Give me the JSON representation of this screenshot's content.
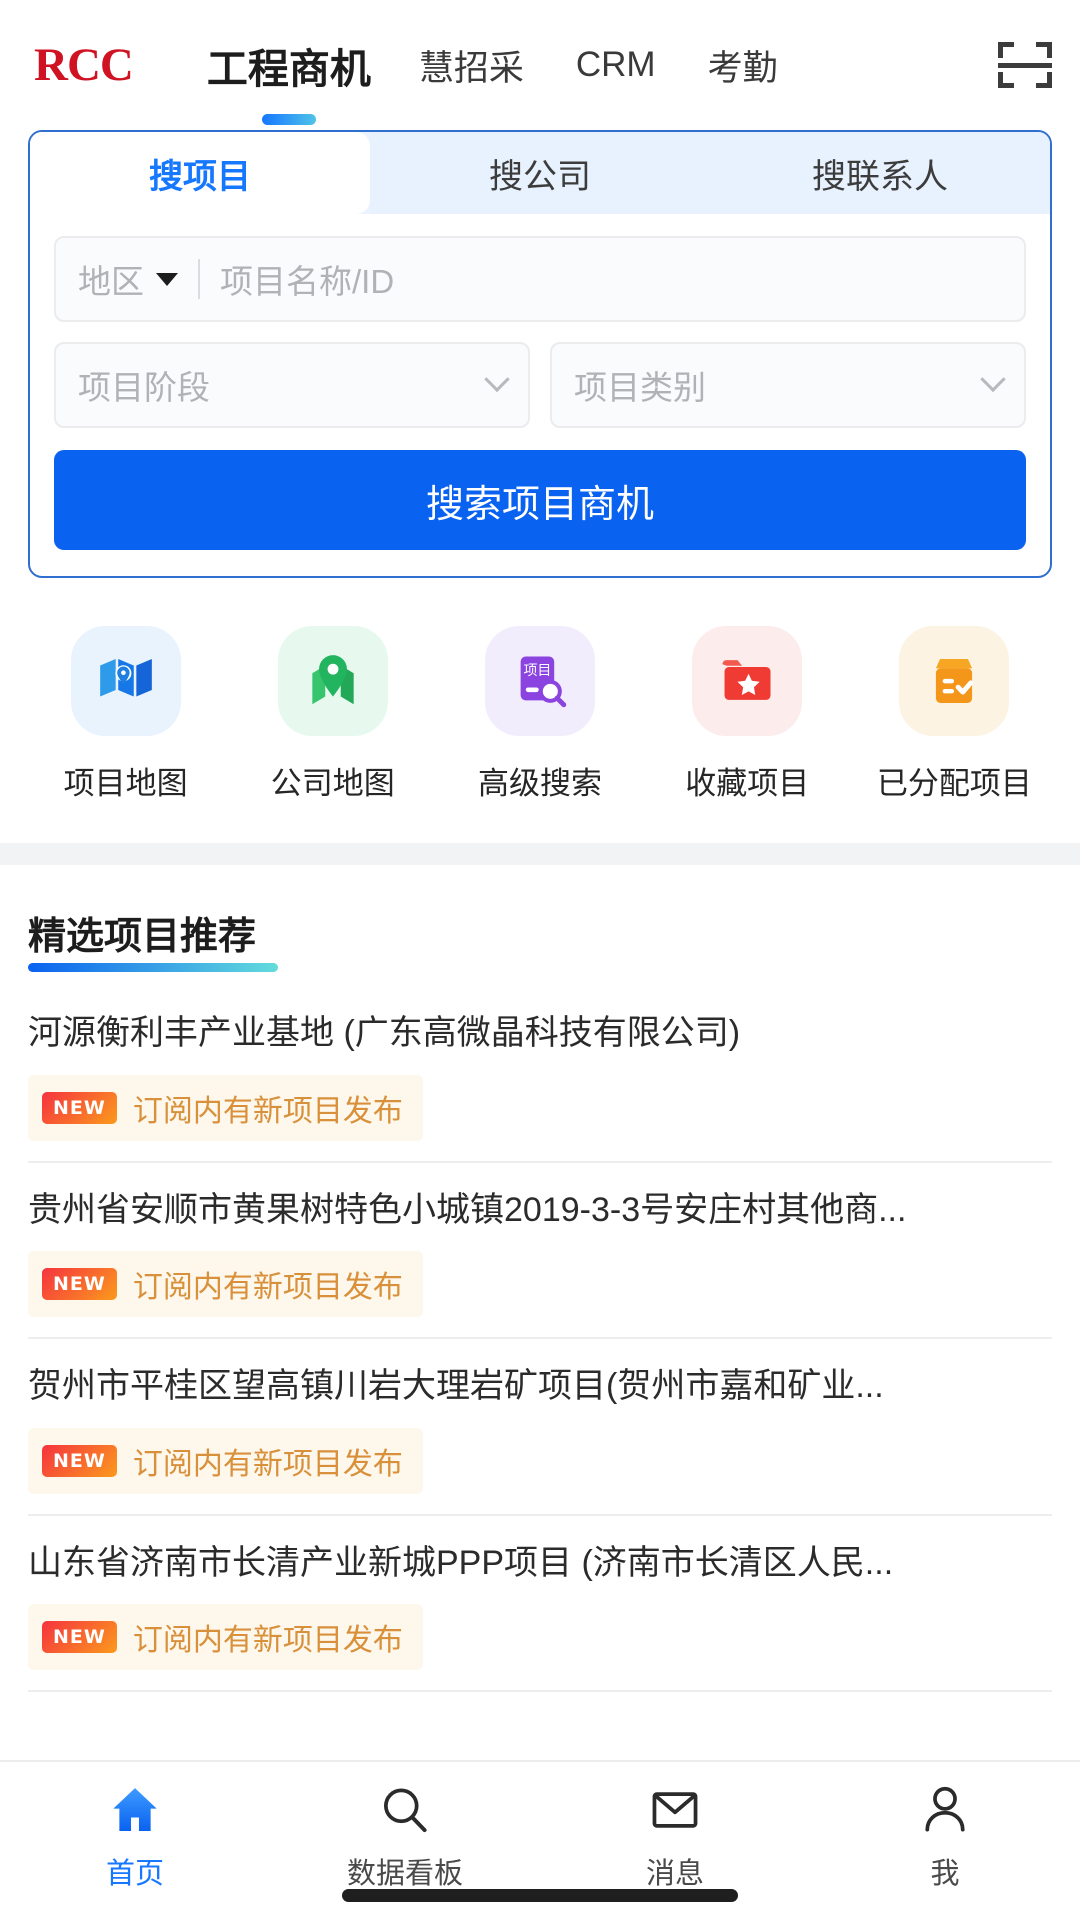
{
  "header": {
    "brand": "RCC",
    "nav": [
      {
        "label": "工程商机",
        "active": true
      },
      {
        "label": "慧招采",
        "active": false
      },
      {
        "label": "CRM",
        "active": false
      },
      {
        "label": "考勤",
        "active": false
      }
    ],
    "scan_icon": "scan-qr-icon"
  },
  "search_card": {
    "tabs": [
      {
        "label": "搜项目",
        "active": true
      },
      {
        "label": "搜公司",
        "active": false
      },
      {
        "label": "搜联系人",
        "active": false
      }
    ],
    "region_label": "地区",
    "keyword_placeholder": "项目名称/ID",
    "stage_placeholder": "项目阶段",
    "category_placeholder": "项目类别",
    "submit_label": "搜索项目商机",
    "accent_color": "#0a62f0"
  },
  "quick_actions": [
    {
      "label": "项目地图",
      "icon": "map-folded-icon",
      "tile_color": "#e8f3fd",
      "glyph_color": "#1f8fe8"
    },
    {
      "label": "公司地图",
      "icon": "map-pin-icon",
      "tile_color": "#e6f8ed",
      "glyph_color": "#1fbf62"
    },
    {
      "label": "高级搜索",
      "icon": "document-search-icon",
      "tile_color": "#f1ecfd",
      "glyph_color": "#8b44e0"
    },
    {
      "label": "收藏项目",
      "icon": "folder-star-icon",
      "tile_color": "#fdeaea",
      "glyph_color": "#ef3b34"
    },
    {
      "label": "已分配项目",
      "icon": "box-check-icon",
      "tile_color": "#fdf2e2",
      "glyph_color": "#f59a1b"
    }
  ],
  "featured": {
    "title": "精选项目推荐",
    "badge_text": "订阅内有新项目发布",
    "badge_chip": "NEW",
    "items": [
      {
        "title": "河源衡利丰产业基地 (广东高微晶科技有限公司)"
      },
      {
        "title": "贵州省安顺市黄果树特色小城镇2019-3-3号安庄村其他商..."
      },
      {
        "title": "贺州市平桂区望高镇川岩大理岩矿项目(贺州市嘉和矿业..."
      },
      {
        "title": "山东省济南市长清产业新城PPP项目 (济南市长清区人民..."
      }
    ]
  },
  "bottom_nav": [
    {
      "label": "首页",
      "icon": "home-icon",
      "active": true
    },
    {
      "label": "数据看板",
      "icon": "search-icon",
      "active": false
    },
    {
      "label": "消息",
      "icon": "envelope-icon",
      "active": false
    },
    {
      "label": "我",
      "icon": "person-icon",
      "active": false
    }
  ]
}
